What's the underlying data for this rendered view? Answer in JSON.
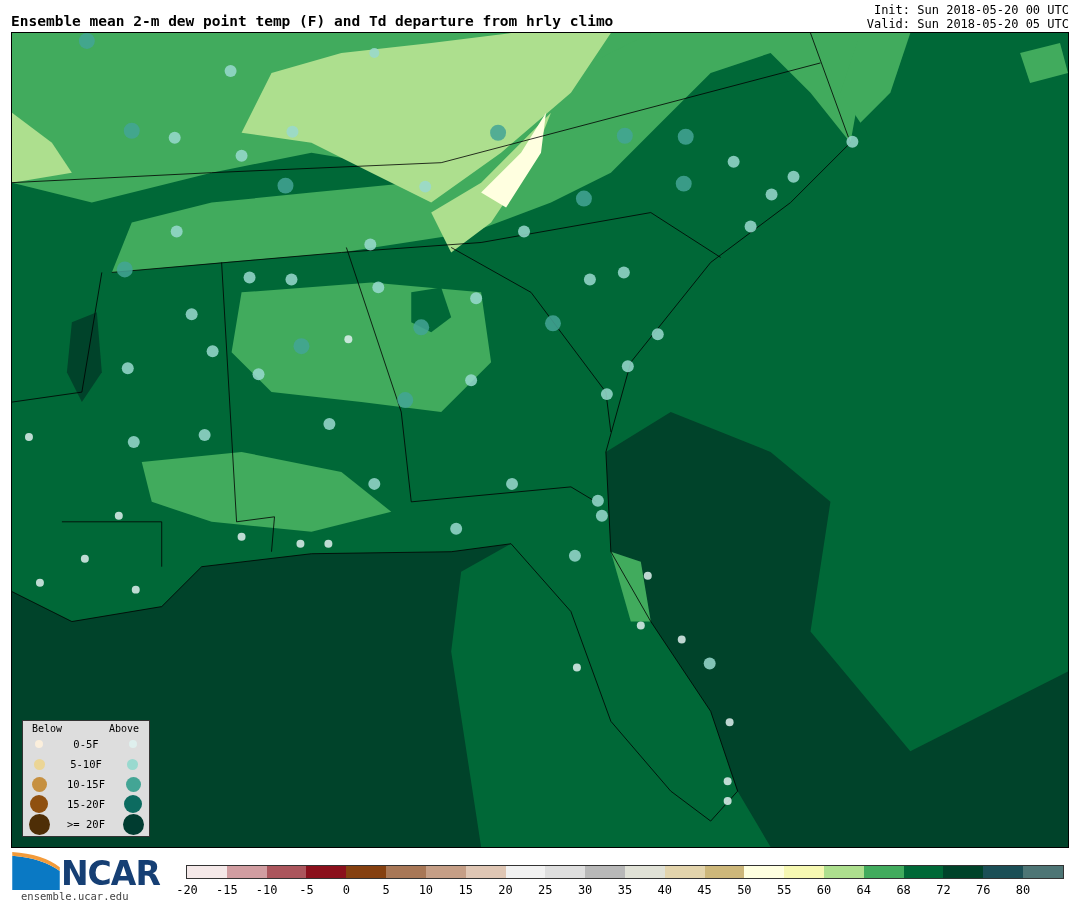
{
  "title": "Ensemble mean 2-m dew point temp (F) and Td departure from hrly climo",
  "init": "Init: Sun 2018-05-20 00 UTC",
  "valid": "Valid: Sun 2018-05-20 05 UTC",
  "legend": {
    "below_heading": "Below",
    "above_heading": "Above",
    "entries": [
      {
        "label": "0-5F",
        "below": {
          "color": "#fbefdc"
        },
        "above": {
          "color": "#dff0ee"
        }
      },
      {
        "label": "5-10F",
        "below": {
          "color": "#ebd595"
        },
        "above": {
          "color": "#99d9cf"
        }
      },
      {
        "label": "10-15F",
        "below": {
          "color": "#c69040"
        },
        "above": {
          "color": "#43a595"
        }
      },
      {
        "label": "15-20F",
        "below": {
          "color": "#8f5010"
        },
        "above": {
          "color": "#0c6b60"
        }
      },
      {
        "label": ">= 20F",
        "below": {
          "color": "#4e2e06"
        },
        "above": {
          "color": "#003c30"
        }
      }
    ]
  },
  "logo": {
    "text": "NCAR",
    "url": "ensemble.ucar.edu"
  },
  "colorbar": [
    {
      "color": "#f4e8e8",
      "label": "-20"
    },
    {
      "color": "#d19da1",
      "label": "-15"
    },
    {
      "color": "#ab555c",
      "label": "-10"
    },
    {
      "color": "#8b101c",
      "label": "-5"
    },
    {
      "color": "#854010",
      "label": "0"
    },
    {
      "color": "#a87756",
      "label": "5"
    },
    {
      "color": "#c59e86",
      "label": "10"
    },
    {
      "color": "#dfc6b4",
      "label": "15"
    },
    {
      "color": "#f1f1f1",
      "label": "20"
    },
    {
      "color": "#dedede",
      "label": "25"
    },
    {
      "color": "#b8b8b8",
      "label": "30"
    },
    {
      "color": "#e0e1d6",
      "label": "35"
    },
    {
      "color": "#e3d4ac",
      "label": "40"
    },
    {
      "color": "#cdb77a",
      "label": "45"
    },
    {
      "color": "#ffffe0",
      "label": "50"
    },
    {
      "color": "#f6f8b2",
      "label": "55"
    },
    {
      "color": "#addf8e",
      "label": "60"
    },
    {
      "color": "#41ab5d",
      "label": "64"
    },
    {
      "color": "#006837",
      "label": "68"
    },
    {
      "color": "#00432a",
      "label": "72"
    },
    {
      "color": "#1b4f56",
      "label": "76"
    },
    {
      "color": "#4d7575",
      "label": "80"
    }
  ]
}
